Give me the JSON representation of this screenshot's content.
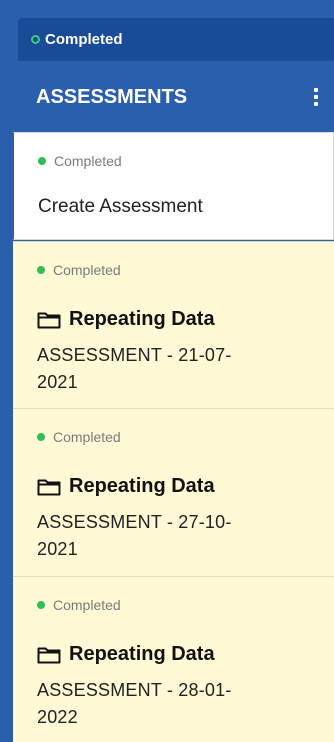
{
  "status_bar": {
    "label": "Completed",
    "dot_color": "#38d074"
  },
  "header": {
    "title": "ASSESSMENTS",
    "menu_icon": "kebab-menu-icon"
  },
  "items": [
    {
      "status": "Completed",
      "label": "Create Assessment"
    },
    {
      "status": "Completed",
      "folder_icon": "folder-icon",
      "title": "Repeating Data",
      "assessment": "ASSESSMENT - 21-07-2021"
    },
    {
      "status": "Completed",
      "folder_icon": "folder-icon",
      "title": "Repeating Data",
      "assessment": "ASSESSMENT - 27-10-2021"
    },
    {
      "status": "Completed",
      "folder_icon": "folder-icon",
      "title": "Repeating Data",
      "assessment": "ASSESSMENT - 28-01-2022"
    }
  ],
  "colors": {
    "panel_blue": "#2a5fae",
    "status_bar_blue": "#1a4b99",
    "item_highlight": "#fff9d6",
    "completed_green": "#2fbf54"
  }
}
